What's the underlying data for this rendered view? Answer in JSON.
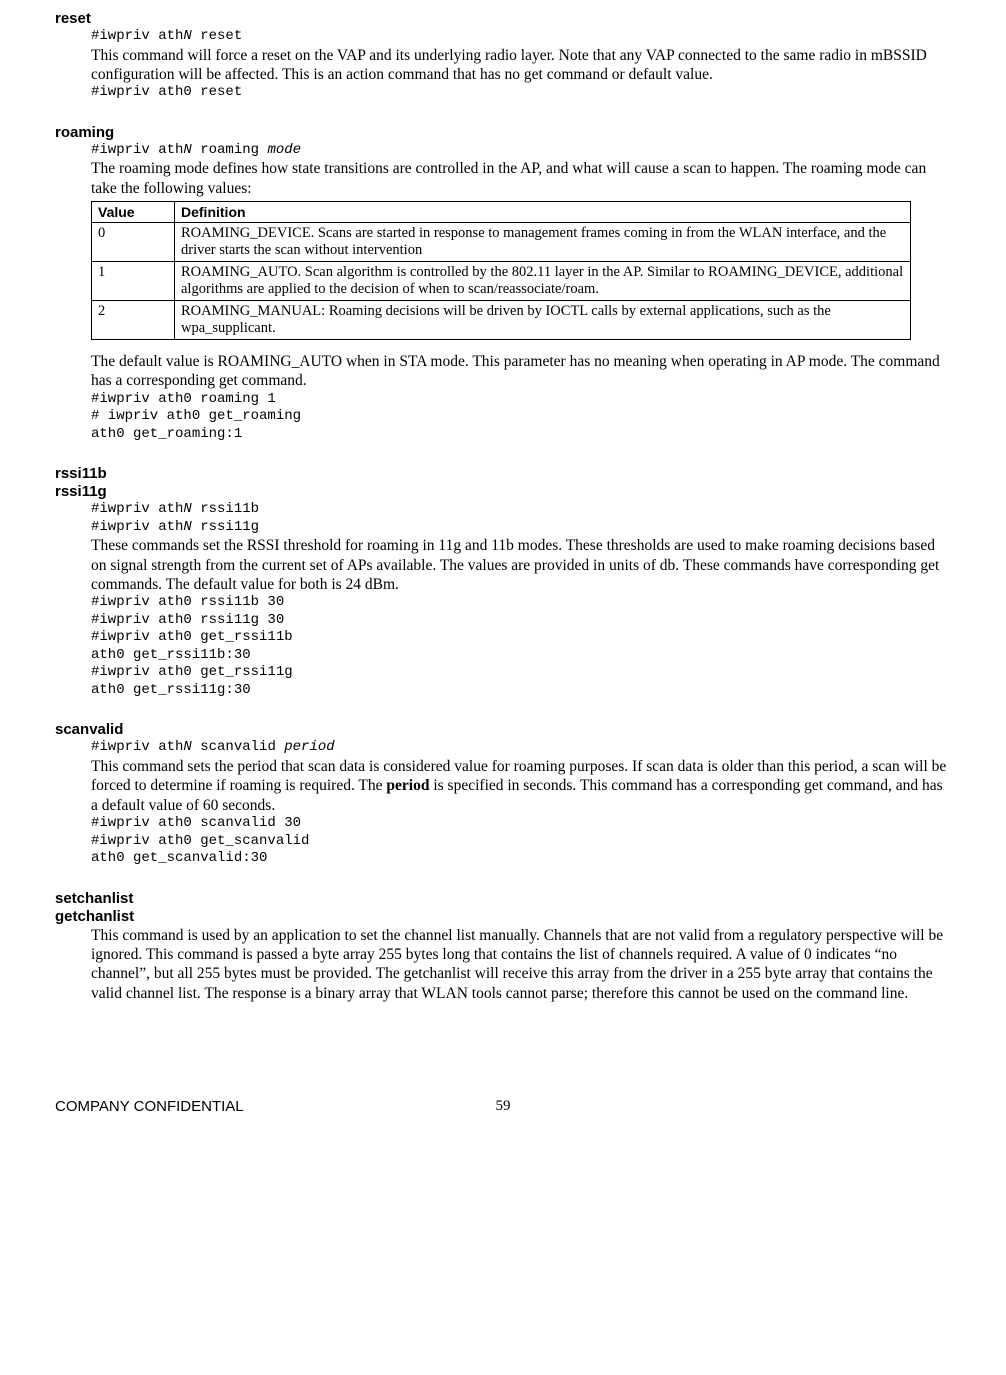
{
  "reset": {
    "head": "reset",
    "syntax_pre": "#iwpriv ath",
    "syntax_var": "N",
    "syntax_post": " reset",
    "desc": "This command will force a reset on the VAP and its underlying radio layer. Note that any VAP connected to the same radio in mBSSID configuration will be affected. This is an action command that has no get command or default value.",
    "ex": "#iwpriv ath0 reset"
  },
  "roaming": {
    "head": "roaming",
    "syntax_pre": "#iwpriv ath",
    "syntax_var1": "N",
    "syntax_mid": " roaming ",
    "syntax_var2": "mode",
    "desc1": "The roaming mode defines how state transitions are controlled in the AP, and what will cause a scan to happen. The roaming mode can take the following values:",
    "th_value": "Value",
    "th_def": "Definition",
    "rows": [
      {
        "v": "0",
        "d": "ROAMING_DEVICE. Scans are started in response to management frames coming in from the WLAN interface, and the driver starts the scan without intervention"
      },
      {
        "v": "1",
        "d": "ROAMING_AUTO. Scan algorithm is controlled by the 802.11 layer in the AP. Similar to ROAMING_DEVICE, additional algorithms are applied to the decision of when to scan/reassociate/roam."
      },
      {
        "v": "2",
        "d": "ROAMING_MANUAL: Roaming decisions will be driven by IOCTL calls by external applications, such as the wpa_supplicant."
      }
    ],
    "desc2": "The default value is ROAMING_AUTO when in STA mode. This parameter has no meaning when operating in AP mode. The command has a corresponding get command.",
    "ex": "#iwpriv ath0 roaming 1\n# iwpriv ath0 get_roaming\nath0 get_roaming:1"
  },
  "rssi": {
    "head_b": "rssi11b",
    "head_g": "rssi11g",
    "syn_b_pre": "#iwpriv ath",
    "syn_b_var": "N",
    "syn_b_post": " rssi11b",
    "syn_g_pre": "#iwpriv ath",
    "syn_g_var": "N",
    "syn_g_post": " rssi11g",
    "desc": "These commands set the RSSI threshold for roaming in 11g and 11b modes. These thresholds are used to make roaming decisions based on signal strength from the current set of APs available. The values are provided in units of db. These commands have corresponding get commands. The default value for both is 24 dBm.",
    "ex": "#iwpriv ath0 rssi11b 30\n#iwpriv ath0 rssi11g 30\n#iwpriv ath0 get_rssi11b\nath0 get_rssi11b:30\n#iwpriv ath0 get_rssi11g\nath0 get_rssi11g:30"
  },
  "scanvalid": {
    "head": "scanvalid",
    "syn_pre": "#iwpriv ath",
    "syn_var1": "N",
    "syn_mid": " scanvalid ",
    "syn_var2": "period",
    "desc_a": "This command sets the period that scan data is considered value for roaming purposes. If scan data is older than this period, a scan will be forced to determine if roaming is required. The ",
    "desc_bold": "period",
    "desc_b": " is specified in seconds. This command has a corresponding get command, and has a default value of 60 seconds.",
    "ex": "#iwpriv ath0 scanvalid 30\n#iwpriv ath0 get_scanvalid\nath0 get_scanvalid:30"
  },
  "chanlist": {
    "head_set": "setchanlist",
    "head_get": "getchanlist",
    "desc": "This command is used by an application to set the channel list manually. Channels that are not valid from a regulatory perspective will be ignored. This command is passed a byte array 255 bytes long that contains the list of channels required. A value of 0 indicates “no channel”, but all 255 bytes must be provided. The getchanlist will receive this array from the driver in a 255 byte array that contains the valid channel list. The response is a binary array that WLAN tools cannot parse; therefore this cannot be used on the command line."
  },
  "footer": {
    "conf": "COMPANY CONFIDENTIAL",
    "page": "59"
  }
}
